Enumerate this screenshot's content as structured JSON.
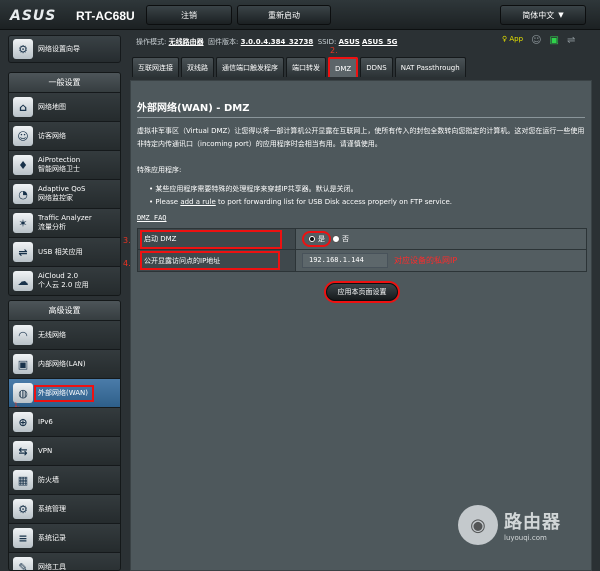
{
  "header": {
    "logo": "ASUS",
    "model": "RT-AC68U",
    "logout": "注销",
    "reboot": "重新启动",
    "language": "简体中文"
  },
  "info": {
    "mode_label": "操作模式:",
    "mode_value": "无线路由器",
    "fw_label": "固件版本:",
    "fw_value": "3.0.0.4.384_32738",
    "ssid_label": "SSID:",
    "ssid1": "ASUS",
    "ssid2": "ASUS_5G",
    "app": "App"
  },
  "sidebar": {
    "wizard": "网络设置向导",
    "general_title": "一般设置",
    "general_items": [
      {
        "l1": "网络地图",
        "l2": ""
      },
      {
        "l1": "访客网络",
        "l2": ""
      },
      {
        "l1": "AiProtection",
        "l2": "智能网络卫士"
      },
      {
        "l1": "Adaptive QoS",
        "l2": "网络监控家"
      },
      {
        "l1": "Traffic Analyzer",
        "l2": "流量分析"
      },
      {
        "l1": "USB 相关应用",
        "l2": ""
      },
      {
        "l1": "AiCloud 2.0",
        "l2": "个人云 2.0 应用"
      }
    ],
    "advanced_title": "高级设置",
    "advanced_items": [
      {
        "l1": "无线网络"
      },
      {
        "l1": "内部网络(LAN)"
      },
      {
        "l1": "外部网络(WAN)"
      },
      {
        "l1": "IPv6"
      },
      {
        "l1": "VPN"
      },
      {
        "l1": "防火墙"
      },
      {
        "l1": "系统管理"
      },
      {
        "l1": "系统记录"
      },
      {
        "l1": "网络工具"
      }
    ]
  },
  "tabs": [
    "互联网连接",
    "双线路",
    "通信端口触发程序",
    "端口转发",
    "DMZ",
    "DDNS",
    "NAT Passthrough"
  ],
  "annotations": {
    "tab": "2.",
    "enable": "3.",
    "ip": "4.",
    "wan": "1."
  },
  "content": {
    "title": "外部网络(WAN) - DMZ",
    "desc": "虚拟非军事区（Virtual DMZ）让您得以将一部计算机公开显露在互联网上，使所有传入的封包全数转向您指定的计算机。这对您在运行一些使用非特定内传通讯口（incoming port）的应用程序时会相当有用。请谨慎使用。",
    "special_title": "特殊应用程序:",
    "bullet1": "某些应用程序需要特殊的处理程序来穿越IP共享器。默认是关闭。",
    "bullet2_pre": "Please",
    "bullet2_link": "add a rule",
    "bullet2_post": "to port forwarding list for USB Disk access properly on FTP service.",
    "faq": "DMZ FAQ",
    "enable_label": "启动 DMZ",
    "yes": "是",
    "no": "否",
    "ip_label": "公开显露访问点的IP地址",
    "ip_value": "192.168.1.144",
    "ip_note": "对应设备的私网IP",
    "apply": "应用本页面设置"
  },
  "watermark": {
    "cn": "路由器",
    "en": "luyouqi.com"
  }
}
